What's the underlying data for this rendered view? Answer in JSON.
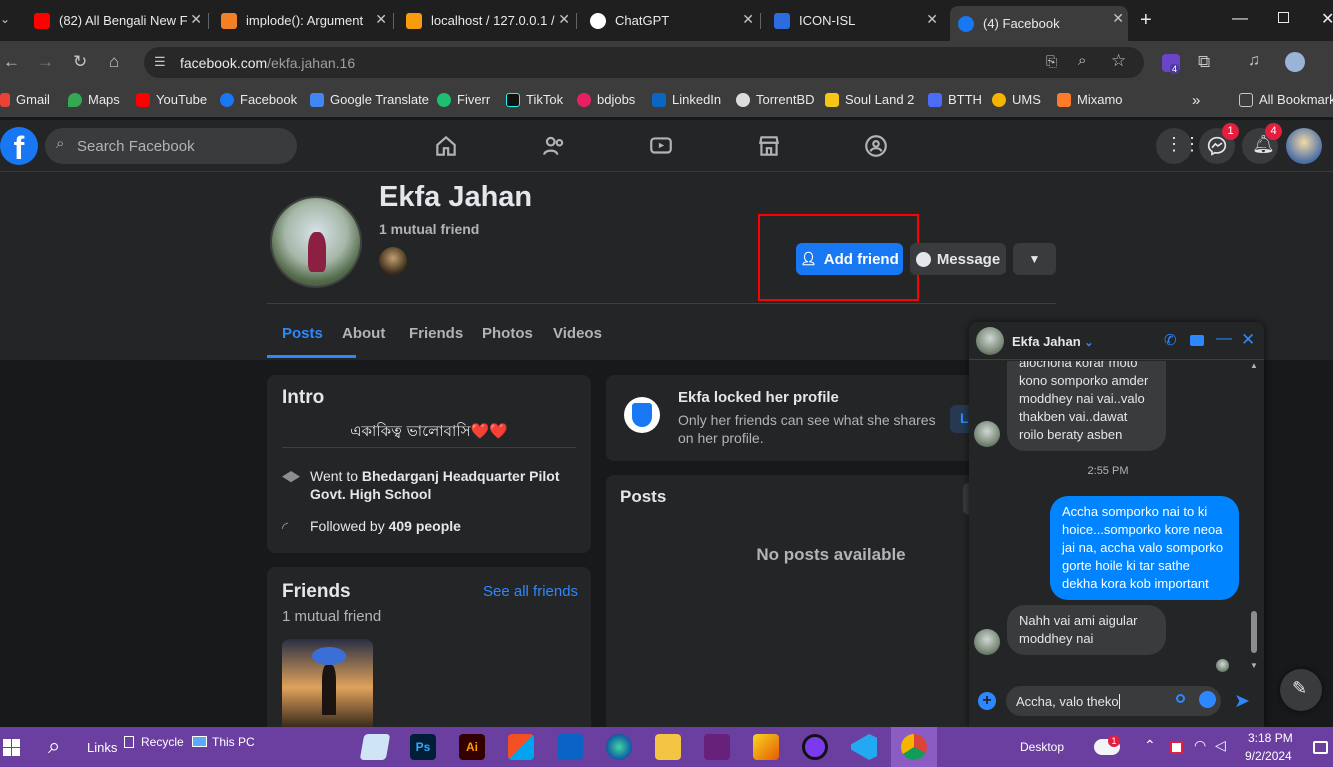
{
  "browser": {
    "tabs": [
      {
        "title": "(82) All Bengali New F",
        "color": "#ff0000"
      },
      {
        "title": "implode(): Argument",
        "color": "#f48024"
      },
      {
        "title": "localhost / 127.0.0.1 /",
        "color": "#f89c0e"
      },
      {
        "title": "ChatGPT",
        "color": "#ffffff"
      },
      {
        "title": "ICON-ISL",
        "color": "#2d6cdf"
      },
      {
        "title": "(4) Facebook",
        "color": "#1877f2"
      }
    ],
    "url_domain": "facebook.com",
    "url_path": "/ekfa.jahan.16",
    "bookmarks": [
      "Gmail",
      "Maps",
      "YouTube",
      "Facebook",
      "Google Translate",
      "Fiverr",
      "TikTok",
      "bdjobs",
      "LinkedIn",
      "TorrentBD",
      "Soul Land 2",
      "BTTH",
      "UMS",
      "Mixamo"
    ],
    "all_bookmarks": "All Bookmarks",
    "extension_badge": "4"
  },
  "fb": {
    "logo": "f",
    "search_placeholder": "Search Facebook",
    "messenger_badge": "1",
    "notifications_badge": "4"
  },
  "profile": {
    "name": "Ekfa Jahan",
    "mutual": "1 mutual friend",
    "add_friend": "Add friend",
    "message": "Message",
    "tabs": [
      "Posts",
      "About",
      "Friends",
      "Photos",
      "Videos"
    ]
  },
  "intro": {
    "title": "Intro",
    "bio": "একাকিত্ব ভালোবাসি❤️❤️",
    "school_prefix": "Went to ",
    "school": "Bhedarganj Headquarter Pilot Govt. High School",
    "followed_prefix": "Followed by ",
    "followers": "409 people"
  },
  "friends": {
    "title": "Friends",
    "see_all": "See all friends",
    "count": "1 mutual friend"
  },
  "locked": {
    "title": "Ekfa locked her profile",
    "text": "Only her friends can see what she shares on her profile.",
    "learn": "Le"
  },
  "posts": {
    "title": "Posts",
    "empty": "No posts available"
  },
  "chat": {
    "name": "Ekfa Jahan",
    "msg1_partial": "alochona korar moto",
    "msg1": "kono somporko amder moddhey nai vai..valo thakben vai..dawat roilo beraty asben",
    "time": "2:55 PM",
    "msg2": "Accha somporko nai to ki hoice...somporko kore neoa jai na, accha valo somporko gorte hoile ki tar sathe dekha kora kob important",
    "msg3": "Nahh vai ami aigular moddhey nai",
    "input": "Accha, valo theko "
  },
  "taskbar": {
    "links": "Links",
    "recycle": "Recycle",
    "thispc": "This PC",
    "desktop": "Desktop",
    "weather_badge": "1",
    "time": "3:18 PM",
    "date": "9/2/2024"
  }
}
